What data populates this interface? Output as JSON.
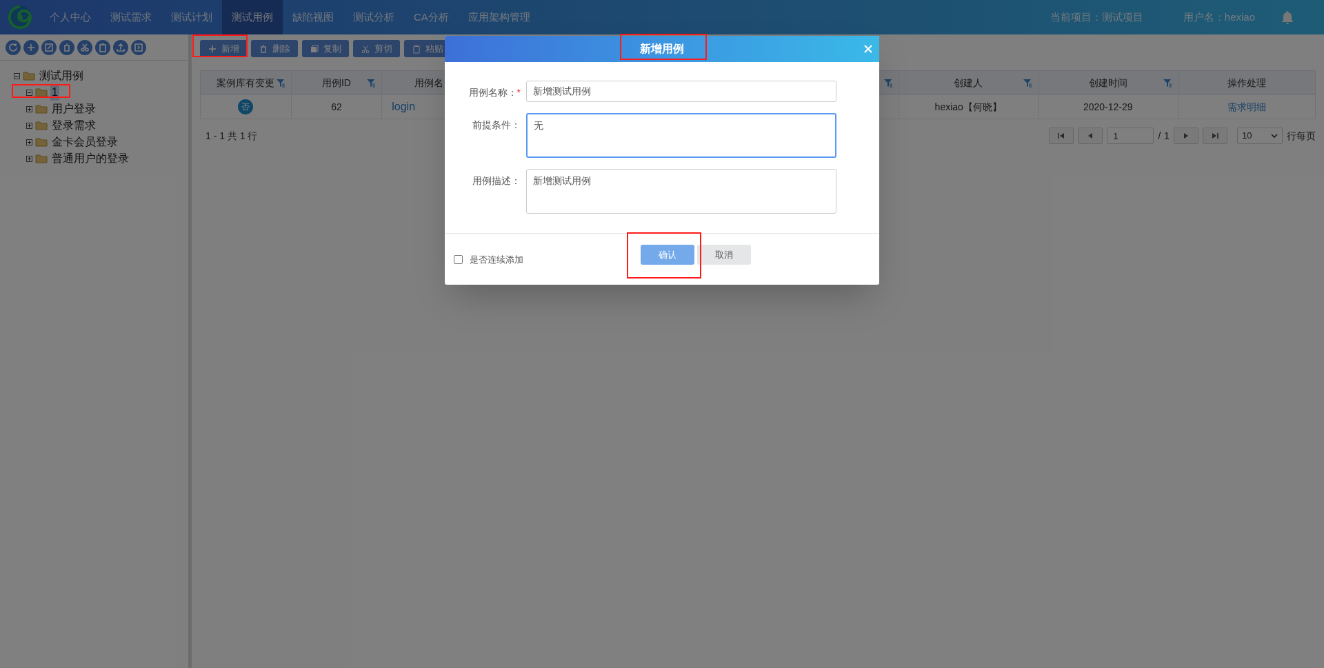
{
  "nav": {
    "items": [
      {
        "label": "个人中心",
        "selected": false
      },
      {
        "label": "测试需求",
        "selected": false
      },
      {
        "label": "测试计划",
        "selected": false
      },
      {
        "label": "测试用例",
        "selected": true
      },
      {
        "label": "缺陷视图",
        "selected": false
      },
      {
        "label": "测试分析",
        "selected": false
      },
      {
        "label": "CA分析",
        "selected": false
      },
      {
        "label": "应用架构管理",
        "selected": false
      }
    ],
    "project": "当前项目：测试项目",
    "user": "用户名：hexiao"
  },
  "sidebar": {
    "tree": [
      {
        "label": "测试用例",
        "expanded": true,
        "selected": false,
        "children": [
          {
            "label": "1",
            "expanded": true,
            "selected": true
          },
          {
            "label": "用户登录",
            "expanded": false,
            "selected": false
          },
          {
            "label": "登录需求",
            "expanded": false,
            "selected": false
          },
          {
            "label": "金卡会员登录",
            "expanded": false,
            "selected": false
          },
          {
            "label": "普通用户的登录",
            "expanded": false,
            "selected": false
          }
        ]
      }
    ]
  },
  "toolbar": [
    {
      "label": "新增",
      "kind": "add"
    },
    {
      "label": "删除",
      "kind": "delete"
    },
    {
      "label": "复制",
      "kind": "copy"
    },
    {
      "label": "剪切",
      "kind": "cut"
    },
    {
      "label": "粘贴",
      "kind": "paste"
    }
  ],
  "table": {
    "columns": [
      {
        "label": "案例库有变更",
        "filter": true
      },
      {
        "label": "用例ID",
        "filter": true
      },
      {
        "label": "用例名",
        "filter": false
      },
      {
        "filter": true
      },
      {
        "label": "创建人",
        "filter": true
      },
      {
        "label": "创建时间",
        "filter": true
      },
      {
        "label": "操作处理",
        "filter": false
      }
    ],
    "rows": [
      {
        "cells": [
          {
            "text": "否",
            "kind": "badge"
          },
          {
            "text": "62",
            "kind": "text"
          },
          {
            "text": "login",
            "kind": "link"
          },
          {
            "text": ""
          },
          {
            "text": "hexiao【何晓】",
            "kind": "text"
          },
          {
            "text": "2020-12-29",
            "kind": "text"
          },
          {
            "text": "需求明细",
            "kind": "link"
          }
        ]
      }
    ]
  },
  "pagination": {
    "summary": "1 - 1 共 1 行",
    "page": "1",
    "total": "/ 1",
    "page_size": "10",
    "per_page_label": "行每页"
  },
  "dialog": {
    "title": "新增用例",
    "fields": [
      {
        "label": "用例名称：",
        "mark": "*",
        "kind": "input",
        "value": "新增测试用例",
        "focused": false
      },
      {
        "label": "前提条件：",
        "kind": "textarea",
        "value": "无",
        "focused": true
      },
      {
        "label": "用例描述：",
        "kind": "textarea",
        "value": "新增测试用例",
        "focused": false
      }
    ],
    "continuous": {
      "label": "是否连续添加",
      "checked": false
    },
    "buttons": [
      {
        "label": "确认",
        "kind": "primary"
      },
      {
        "label": "取消",
        "kind": "secondary"
      }
    ]
  }
}
